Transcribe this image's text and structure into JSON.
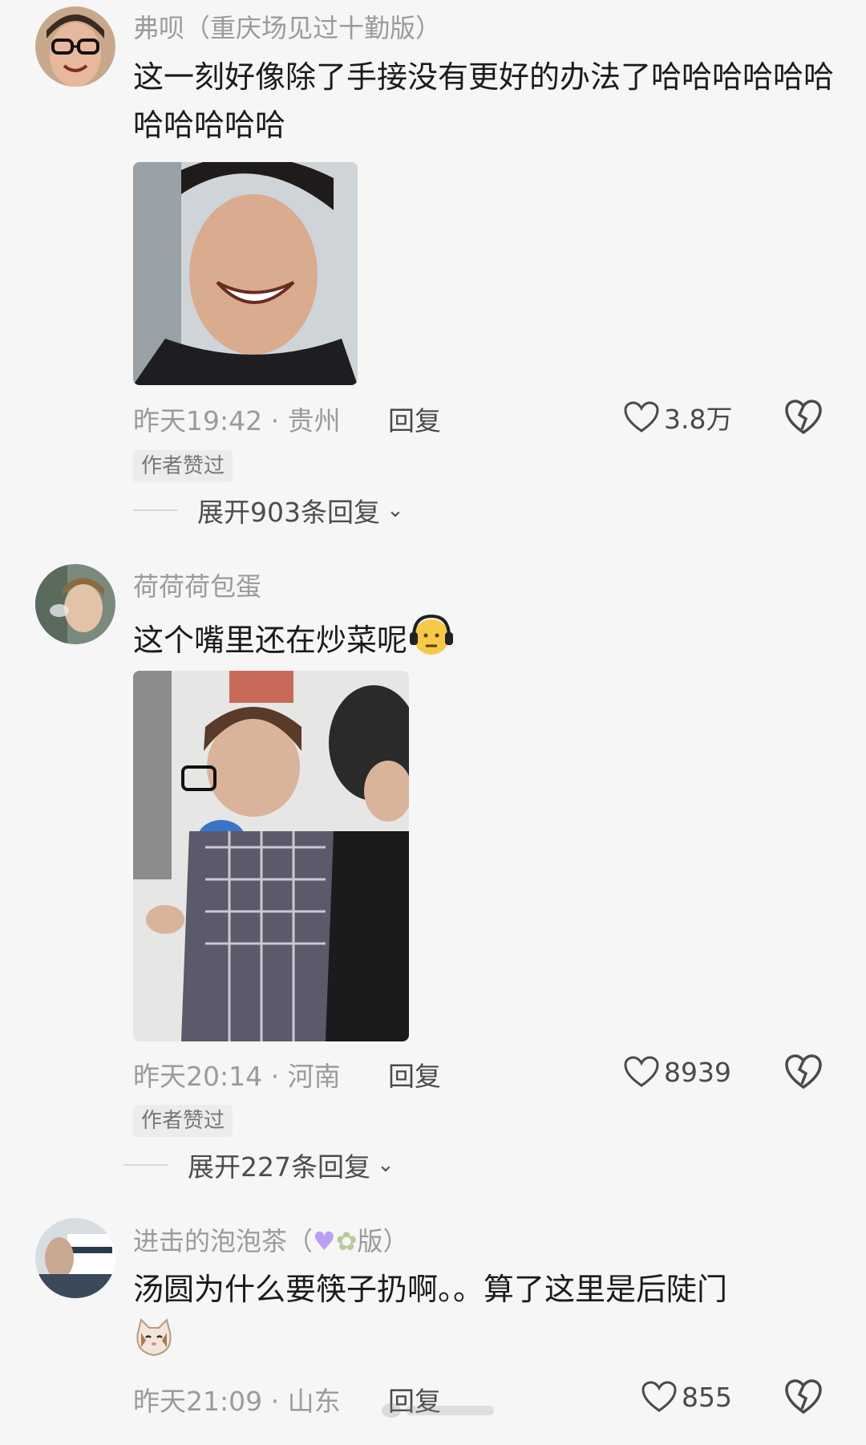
{
  "comments": [
    {
      "username": "弗呗（重庆场见过十勤版）",
      "text": "这一刻好像除了手接没有更好的办法了哈哈哈哈哈哈哈哈哈哈哈",
      "time": "昨天19:42",
      "separator": "·",
      "location": "贵州",
      "reply_label": "回复",
      "likes": "3.8万",
      "badge": "作者赞过",
      "expand_label": "展开903条回复"
    },
    {
      "username": "荷荷荷包蛋",
      "text": "这个嘴里还在炒菜呢",
      "time": "昨天20:14",
      "separator": "·",
      "location": "河南",
      "reply_label": "回复",
      "likes": "8939",
      "badge": "作者赞过",
      "expand_label": "展开227条回复"
    },
    {
      "username_prefix": "进击的泡泡茶（",
      "username_suffix": "版）",
      "text": "汤圆为什么要筷子扔啊。。算了这里是后陡门",
      "time": "昨天21:09",
      "separator": "·",
      "location": "山东",
      "reply_label": "回复",
      "likes": "855"
    }
  ],
  "icons": {
    "like": "heart-outline-icon",
    "dislike": "broken-heart-icon",
    "expand": "chevron-down-icon"
  },
  "colors": {
    "background": "#f6f6f6",
    "username": "#9b9b9b",
    "text": "#1b1b1b",
    "meta": "#9b9b9b"
  }
}
